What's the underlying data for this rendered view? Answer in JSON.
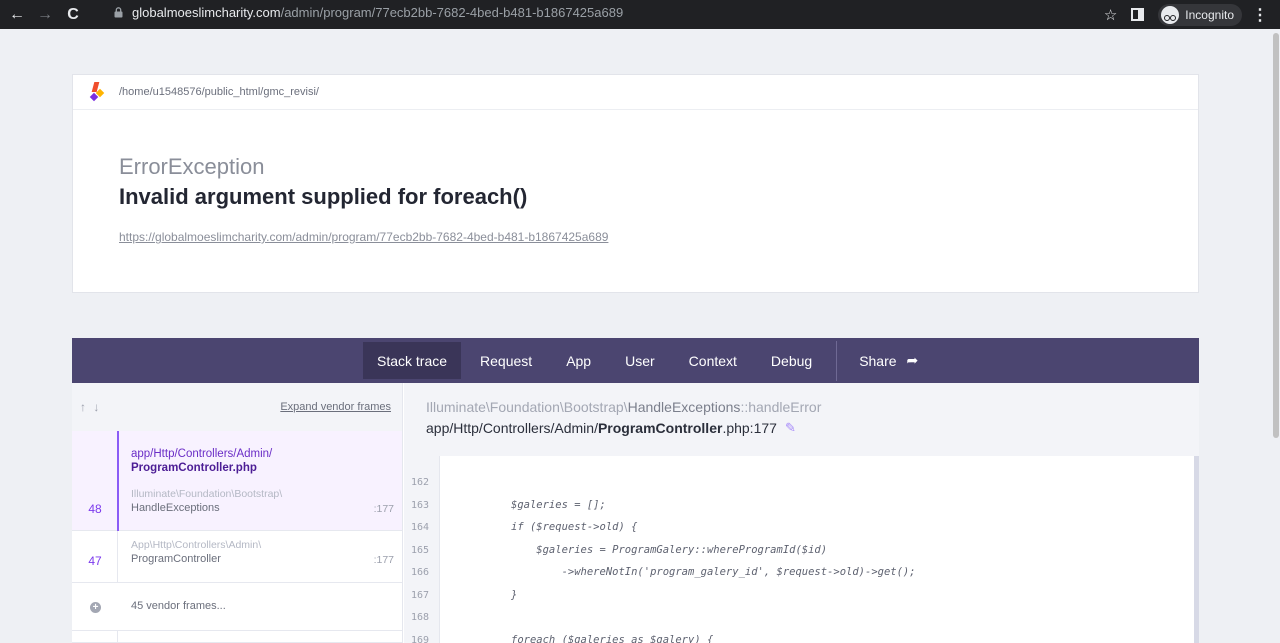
{
  "browser": {
    "url_host": "globalmoeslimcharity.com",
    "url_path": "/admin/program/77ecb2bb-7682-4bed-b481-b1867425a689",
    "incognito_label": "Incognito"
  },
  "header": {
    "app_path": "/home/u1548576/public_html/gmc_revisi/",
    "exception_class": "ErrorException",
    "exception_message": "Invalid argument supplied for foreach()",
    "request_url": "https://globalmoeslimcharity.com/admin/program/77ecb2bb-7682-4bed-b481-b1867425a689"
  },
  "tabs": {
    "stack_trace": "Stack trace",
    "request": "Request",
    "app": "App",
    "user": "User",
    "context": "Context",
    "debug": "Debug",
    "share": "Share"
  },
  "frames_panel": {
    "arrows": "↑ ↓",
    "expand_label": "Expand vendor frames",
    "active": {
      "file_dir": "app/Http/Controllers/Admin/",
      "file_name": "ProgramController.php",
      "number": "48",
      "namespace": "Illuminate\\Foundation\\Bootstrap\\",
      "class": "HandleExceptions",
      "line": ":177"
    },
    "second": {
      "number": "47",
      "namespace": "App\\Http\\Controllers\\Admin\\",
      "class": "ProgramController",
      "line": ":177"
    },
    "vendor_frames": "45 vendor frames..."
  },
  "source": {
    "ns_prefix": "Illuminate\\Foundation\\Bootstrap\\",
    "ns_class": "HandleExceptions",
    "ns_method": "::handleError",
    "file_prefix": "app/Http/Controllers/Admin/",
    "file_name": "ProgramController",
    "file_suffix": ".php:177",
    "line_numbers": [
      "162",
      "163",
      "164",
      "165",
      "166",
      "167",
      "168",
      "169"
    ],
    "code_lines": [
      "",
      "$galeries = [];",
      "if ($request->old) {",
      "    $galeries = ProgramGalery::whereProgramId($id)",
      "        ->whereNotIn('program_galery_id', $request->old)->get();",
      "}",
      "",
      "foreach ($galeries as $galery) {"
    ]
  }
}
